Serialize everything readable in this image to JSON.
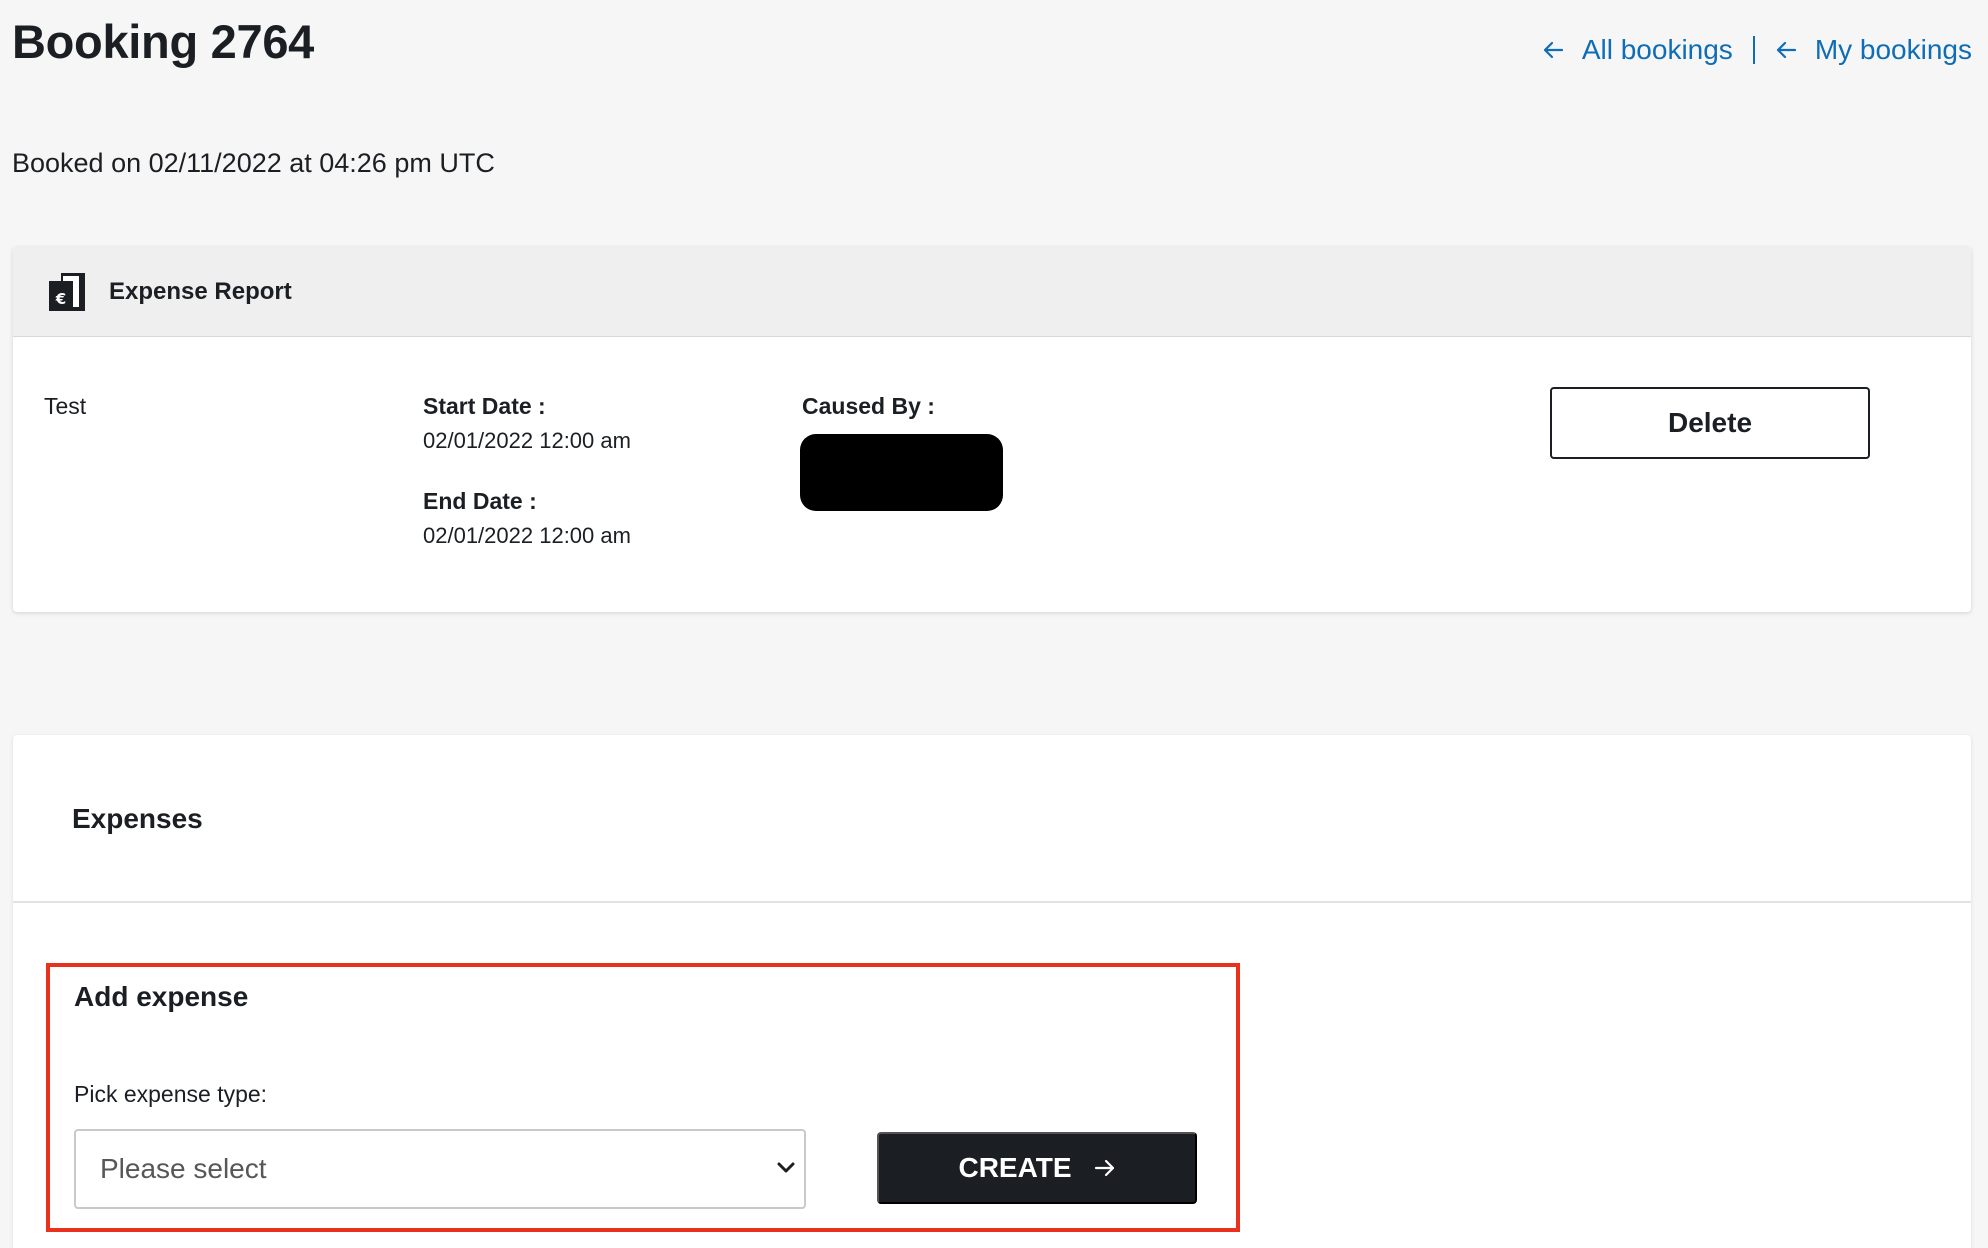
{
  "header": {
    "title": "Booking 2764",
    "nav": {
      "all_bookings": "All bookings",
      "my_bookings": "My bookings"
    }
  },
  "booked_on": "Booked on 02/11/2022 at 04:26 pm UTC",
  "report": {
    "header_title": "Expense Report",
    "icon": "euro-document-icon",
    "name": "Test",
    "start_label": "Start Date :",
    "start_value": "02/01/2022 12:00 am",
    "end_label": "End Date :",
    "end_value": "02/01/2022 12:00 am",
    "caused_by_label": "Caused By :",
    "delete_label": "Delete"
  },
  "expenses": {
    "title": "Expenses",
    "add": {
      "title": "Add expense",
      "pick_label": "Pick expense type:",
      "select_value": "Please select",
      "create_label": "CREATE"
    }
  },
  "colors": {
    "link": "#0f6db5",
    "highlight": "#e8321e",
    "dark_button": "#1b1f24",
    "background": "#f6f6f6"
  }
}
